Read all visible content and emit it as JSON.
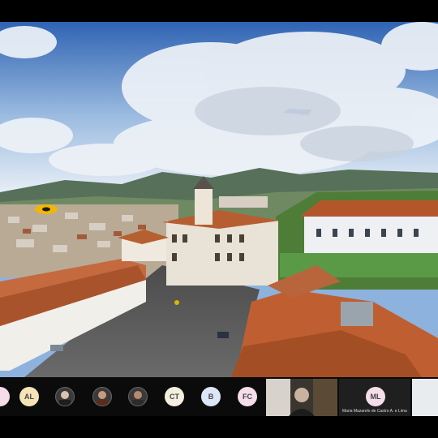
{
  "participants": [
    {
      "initials": "",
      "color": "#f4dce8",
      "partial": true
    },
    {
      "initials": "AL",
      "color": "#f6e4b8"
    },
    {
      "initials": "",
      "photo": true,
      "icon": "person-photo-icon"
    },
    {
      "initials": "",
      "photo": true,
      "icon": "person-photo-icon"
    },
    {
      "initials": "",
      "photo": true,
      "icon": "person-photo-icon"
    },
    {
      "initials": "CT",
      "color": "#f3eedd"
    },
    {
      "initials": "B",
      "color": "#dde6f6"
    },
    {
      "initials": "FC",
      "color": "#f5dde9"
    }
  ],
  "video_tiles": [
    {
      "name": "",
      "type": "camera"
    },
    {
      "name": "Maria Mazarelo de Castro A. e Lima",
      "initials": "ML",
      "color": "#f5dde9"
    }
  ],
  "screen_share": {
    "subject": "aerial-panorama",
    "colors": {
      "sky": "#3e6fb9",
      "roof": "#b3572b",
      "grass": "#4f8a3a"
    }
  }
}
